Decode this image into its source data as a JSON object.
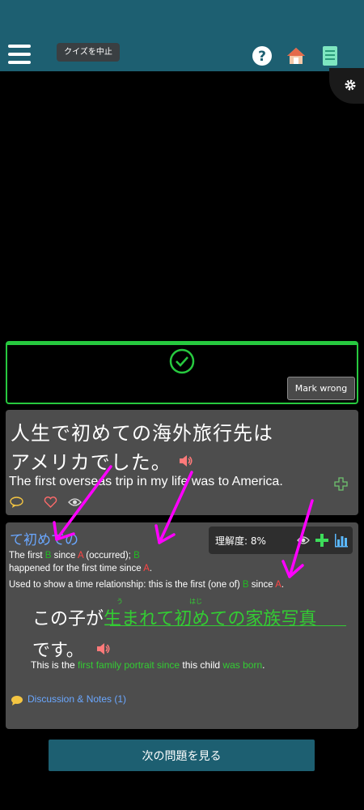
{
  "header": {
    "stop_quiz_label": "クイズを中止",
    "icons": [
      "menu-icon",
      "help-icon",
      "home-icon",
      "book-icon"
    ],
    "color": "#1d5f71"
  },
  "settings": {
    "icon": "gear-icon"
  },
  "result": {
    "status": "correct",
    "icon": "check-circle-icon",
    "mark_wrong_label": "Mark wrong",
    "accent": "#27c93f"
  },
  "sentence": {
    "jp_line1": "人生で初めての海外旅行先は",
    "jp_line2": "アメリカでした。",
    "en": "The first overseas trip in my life was to America.",
    "actions": [
      "speaker-icon",
      "plus-icon",
      "comment-icon",
      "heart-icon",
      "eye-icon"
    ]
  },
  "grammar": {
    "title": "て初めての",
    "understanding": "理解度: 8%",
    "def1_a": "The first ",
    "def1_b": "B",
    "def1_c": " since ",
    "def1_d": "A",
    "def1_e": " (occurred); ",
    "def1_f": "B",
    "def2_a": "happened for the first time since ",
    "def2_b": "A",
    "def2_c": ".",
    "def3_a": "Used to show a time relationship: this is the first (one of) ",
    "def3_b": "B",
    "def3_c": " since ",
    "def3_d": "A",
    "def3_e": ".",
    "example": {
      "jp_a": "この子が",
      "jp_b": "生まれて初めての家族写真",
      "jp_line2": "です。",
      "furi1": "う",
      "furi2": "はじ",
      "en_a": "This is the ",
      "en_b": "first family portrait since",
      "en_c": " this child ",
      "en_d": "was born",
      "en_e": "."
    },
    "notes_label": "Discussion & Notes (1)"
  },
  "next_label": "次の問題を見る",
  "colors": {
    "accent_green": "#33cc33",
    "link_blue": "#6aa7ff",
    "annotation_magenta": "#ff00ff"
  }
}
